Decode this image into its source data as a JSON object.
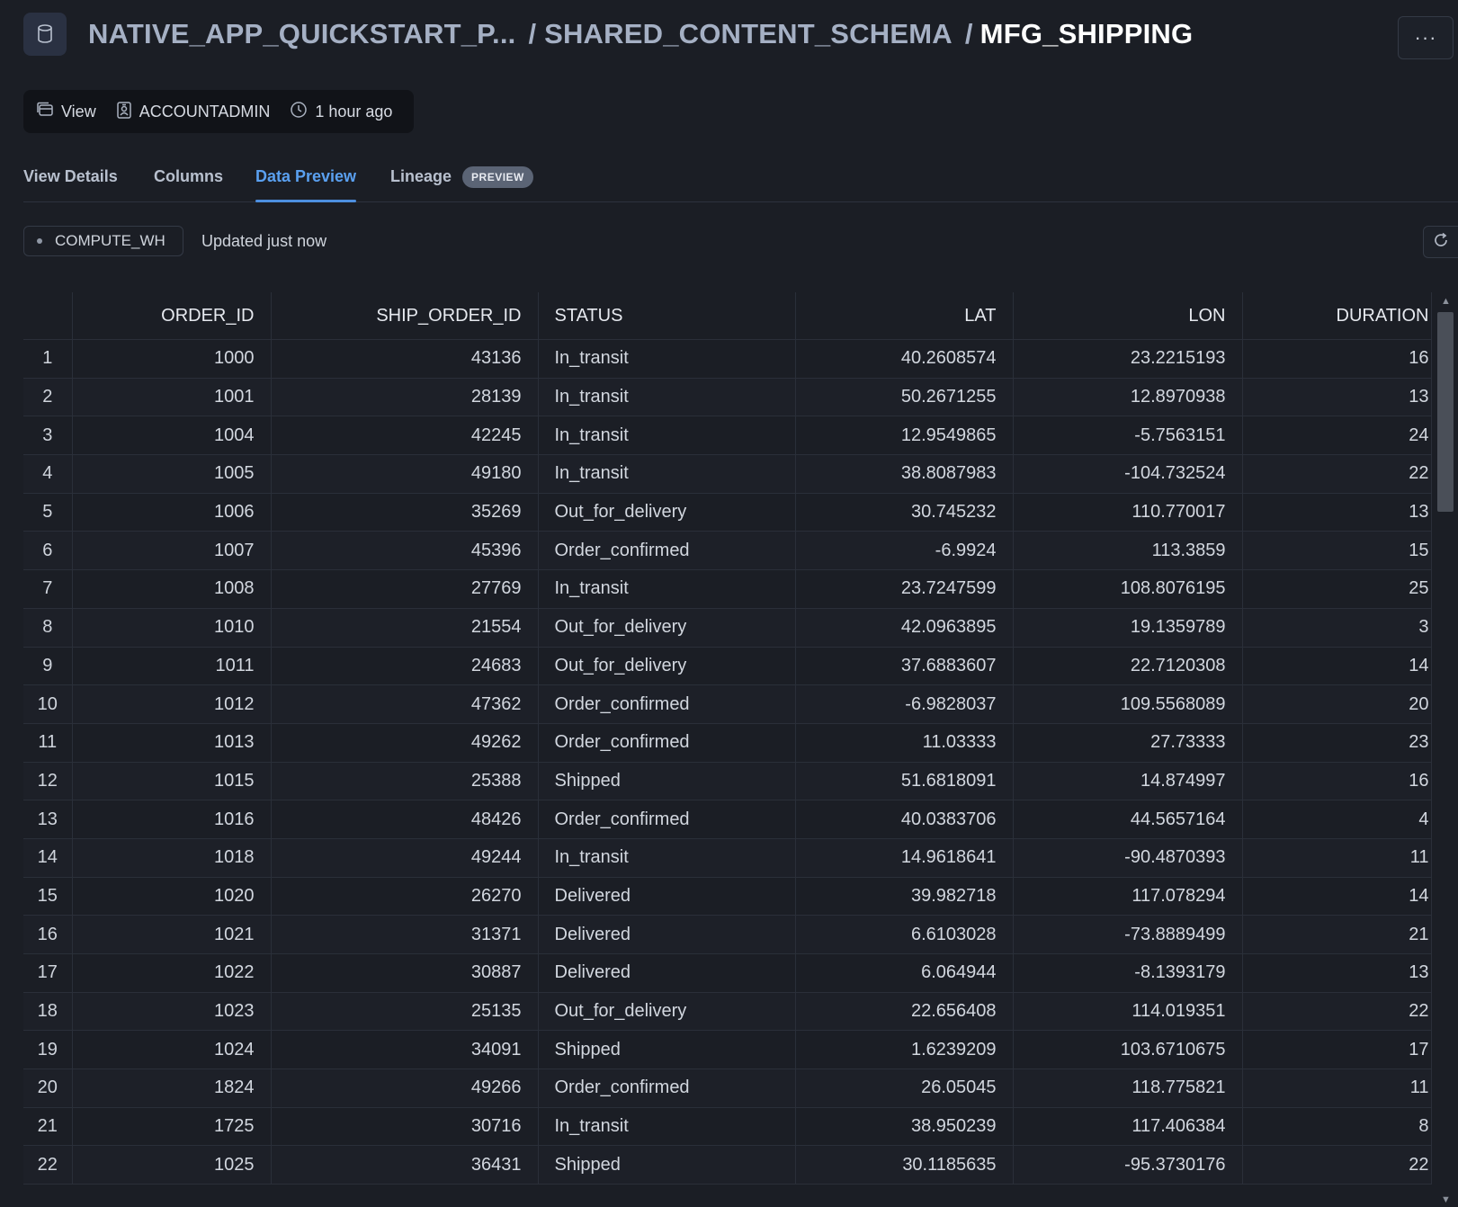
{
  "header": {
    "breadcrumb_database": "NATIVE_APP_QUICKSTART_P...",
    "breadcrumb_schema": "/ SHARED_CONTENT_SCHEMA",
    "breadcrumb_separator": "/",
    "breadcrumb_object": "MFG_SHIPPING",
    "more_label": "···",
    "icon": "database-icon"
  },
  "meta": {
    "type_label": "View",
    "owner_label": "ACCOUNTADMIN",
    "time_label": "1 hour ago"
  },
  "tabs": [
    {
      "label": "View Details"
    },
    {
      "label": "Columns"
    },
    {
      "label": "Data Preview",
      "active": true
    },
    {
      "label": "Lineage",
      "badge": "PREVIEW"
    }
  ],
  "toolbar": {
    "warehouse": "COMPUTE_WH",
    "updated": "Updated just now"
  },
  "table": {
    "columns": [
      "ORDER_ID",
      "SHIP_ORDER_ID",
      "STATUS",
      "LAT",
      "LON",
      "DURATION"
    ],
    "rows": [
      [
        "1",
        "1000",
        "43136",
        "In_transit",
        "40.2608574",
        "23.2215193",
        "16"
      ],
      [
        "2",
        "1001",
        "28139",
        "In_transit",
        "50.2671255",
        "12.8970938",
        "13"
      ],
      [
        "3",
        "1004",
        "42245",
        "In_transit",
        "12.9549865",
        "-5.7563151",
        "24"
      ],
      [
        "4",
        "1005",
        "49180",
        "In_transit",
        "38.8087983",
        "-104.732524",
        "22"
      ],
      [
        "5",
        "1006",
        "35269",
        "Out_for_delivery",
        "30.745232",
        "110.770017",
        "13"
      ],
      [
        "6",
        "1007",
        "45396",
        "Order_confirmed",
        "-6.9924",
        "113.3859",
        "15"
      ],
      [
        "7",
        "1008",
        "27769",
        "In_transit",
        "23.7247599",
        "108.8076195",
        "25"
      ],
      [
        "8",
        "1010",
        "21554",
        "Out_for_delivery",
        "42.0963895",
        "19.1359789",
        "3"
      ],
      [
        "9",
        "1011",
        "24683",
        "Out_for_delivery",
        "37.6883607",
        "22.7120308",
        "14"
      ],
      [
        "10",
        "1012",
        "47362",
        "Order_confirmed",
        "-6.9828037",
        "109.5568089",
        "20"
      ],
      [
        "11",
        "1013",
        "49262",
        "Order_confirmed",
        "11.03333",
        "27.73333",
        "23"
      ],
      [
        "12",
        "1015",
        "25388",
        "Shipped",
        "51.6818091",
        "14.874997",
        "16"
      ],
      [
        "13",
        "1016",
        "48426",
        "Order_confirmed",
        "40.0383706",
        "44.5657164",
        "4"
      ],
      [
        "14",
        "1018",
        "49244",
        "In_transit",
        "14.9618641",
        "-90.4870393",
        "11"
      ],
      [
        "15",
        "1020",
        "26270",
        "Delivered",
        "39.982718",
        "117.078294",
        "14"
      ],
      [
        "16",
        "1021",
        "31371",
        "Delivered",
        "6.6103028",
        "-73.8889499",
        "21"
      ],
      [
        "17",
        "1022",
        "30887",
        "Delivered",
        "6.064944",
        "-8.1393179",
        "13"
      ],
      [
        "18",
        "1023",
        "25135",
        "Out_for_delivery",
        "22.656408",
        "114.019351",
        "22"
      ],
      [
        "19",
        "1024",
        "34091",
        "Shipped",
        "1.6239209",
        "103.6710675",
        "17"
      ],
      [
        "20",
        "1824",
        "49266",
        "Order_confirmed",
        "26.05045",
        "118.775821",
        "11"
      ],
      [
        "21",
        "1725",
        "30716",
        "In_transit",
        "38.950239",
        "117.406384",
        "8"
      ],
      [
        "22",
        "1025",
        "36431",
        "Shipped",
        "30.1185635",
        "-95.3730176",
        "22"
      ]
    ]
  }
}
